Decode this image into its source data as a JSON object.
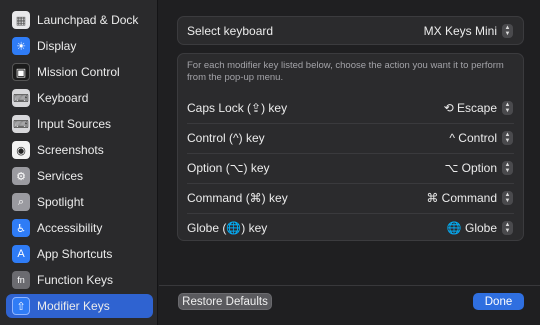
{
  "sidebar": {
    "items": [
      {
        "label": "Launchpad & Dock",
        "icon": "launchpad-dock-icon",
        "color": "#e8e8ea",
        "glyph": "▦",
        "selected": false
      },
      {
        "label": "Display",
        "icon": "display-icon",
        "color": "#2f7cf6",
        "glyph": "☀",
        "selected": false
      },
      {
        "label": "Mission Control",
        "icon": "mission-control-icon",
        "color": "#1c1c1c",
        "glyph": "▣",
        "selected": false
      },
      {
        "label": "Keyboard",
        "icon": "keyboard-icon",
        "color": "#d7d7da",
        "glyph": "⌨",
        "selected": false
      },
      {
        "label": "Input Sources",
        "icon": "input-sources-icon",
        "color": "#d7d7da",
        "glyph": "⌨",
        "selected": false
      },
      {
        "label": "Screenshots",
        "icon": "screenshots-icon",
        "color": "#f2f2f2",
        "glyph": "◉",
        "selected": false
      },
      {
        "label": "Services",
        "icon": "services-icon",
        "color": "#9a9aa0",
        "glyph": "⚙",
        "selected": false
      },
      {
        "label": "Spotlight",
        "icon": "spotlight-icon",
        "color": "#9a9aa0",
        "glyph": "⌕",
        "selected": false
      },
      {
        "label": "Accessibility",
        "icon": "accessibility-icon",
        "color": "#2f7cf6",
        "glyph": "♿",
        "selected": false
      },
      {
        "label": "App Shortcuts",
        "icon": "app-shortcuts-icon",
        "color": "#2f7cf6",
        "glyph": "A",
        "selected": false
      },
      {
        "label": "Function Keys",
        "icon": "function-keys-icon",
        "color": "#6b6b70",
        "glyph": "fn",
        "selected": false
      },
      {
        "label": "Modifier Keys",
        "icon": "modifier-keys-icon",
        "color": "#2f7cf6",
        "glyph": "⇧",
        "selected": true
      }
    ]
  },
  "keyboard_select": {
    "label": "Select keyboard",
    "value": "MX Keys Mini"
  },
  "modifiers": {
    "description": "For each modifier key listed below, choose the action you want it to perform from the pop-up menu.",
    "rows": [
      {
        "label": "Caps Lock (⇪) key",
        "value": "⟲ Escape"
      },
      {
        "label": "Control (^) key",
        "value": "^ Control"
      },
      {
        "label": "Option (⌥) key",
        "value": "⌥ Option"
      },
      {
        "label": "Command (⌘) key",
        "value": "⌘ Command"
      },
      {
        "label": "Globe (🌐) key",
        "value": "🌐 Globe"
      }
    ]
  },
  "buttons": {
    "restore": "Restore Defaults",
    "done": "Done"
  },
  "colors": {
    "accent": "#2f6fe0",
    "selection": "#2f63d1"
  }
}
